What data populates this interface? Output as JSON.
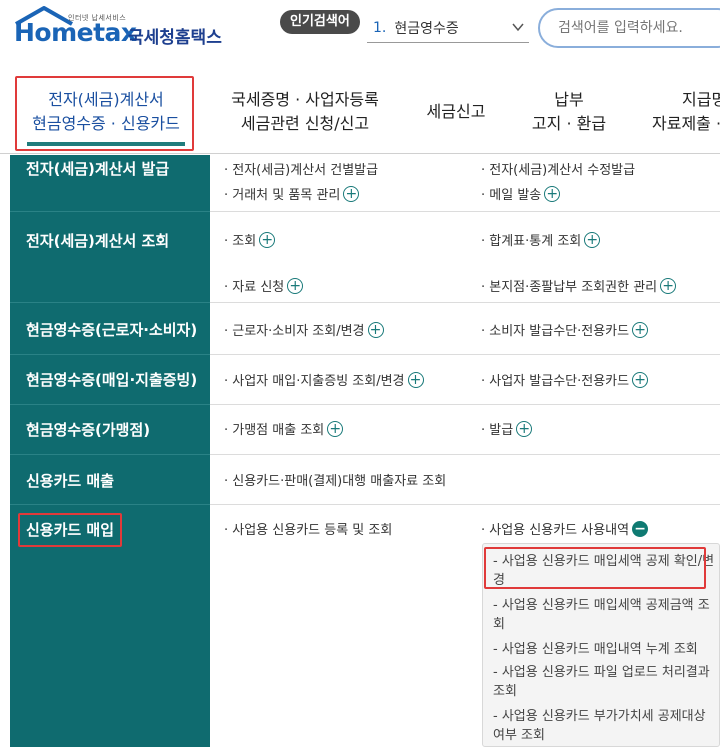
{
  "header": {
    "logo_tagline": "인터넷 납세서비스",
    "logo_text": "Hometax",
    "logo_subtitle": "국세청홈택스",
    "popular_label": "인기검색어",
    "popular_rank": "1.",
    "popular_value": "현금영수증",
    "search_placeholder": "검색어를 입력하세요."
  },
  "nav": {
    "items": [
      {
        "line1": "전자(세금)계산서",
        "line2": "현금영수증 · 신용카드"
      },
      {
        "line1": "국세증명 · 사업자등록",
        "line2": "세금관련 신청/신고"
      },
      {
        "line1": "세금신고",
        "line2": ""
      },
      {
        "line1": "납부",
        "line2": "고지 · 환급"
      },
      {
        "line1": "지급명",
        "line2": "자료제출 ·"
      }
    ]
  },
  "sidebar": {
    "items": [
      {
        "label": "전자(세금)계산서 발급"
      },
      {
        "label": "전자(세금)계산서 조회"
      },
      {
        "label": "현금영수증(근로자·소비자)"
      },
      {
        "label": "현금영수증(매입·지출증빙)"
      },
      {
        "label": "현금영수증(가맹점)"
      },
      {
        "label": "신용카드 매출"
      },
      {
        "label": "신용카드 매입"
      }
    ]
  },
  "menu": {
    "r1c1a": "· 전자(세금)계산서 건별발급",
    "r1c1b": "· 거래처 및 품목 관리",
    "r1c2a": "· 전자(세금)계산서 수정발급",
    "r1c2b": "· 메일 발송",
    "r2c1a": "· 조회",
    "r2c1b": "· 자료 신청",
    "r2c2a": "· 합계표·통계 조회",
    "r2c2b": "· 본지점·종팔납부 조회권한 관리",
    "r3c1": "· 근로자·소비자 조회/변경",
    "r3c2": "· 소비자 발급수단·전용카드",
    "r4c1": "· 사업자 매입·지출증빙 조회/변경",
    "r4c2": "· 사업자 발급수단·전용카드",
    "r5c1": "· 가맹점 매출 조회",
    "r5c2": "· 발급",
    "r6c1": "· 신용카드·판매(결제)대행 매출자료 조회",
    "r7c1": "· 사업용 신용카드 등록 및 조회",
    "r7c2": "· 사업용 신용카드 사용내역"
  },
  "submenu": [
    "- 사업용 신용카드 매입세액 공제 확인/변경",
    "- 사업용 신용카드 매입세액 공제금액 조회",
    "- 사업용 신용카드 매입내역 누계 조회",
    "- 사업용 신용카드 파일 업로드 처리결과 조회",
    "- 사업용 신용카드 부가가치세 공제대상 여부 조회"
  ],
  "colors": {
    "sidebar_bg": "#0f6b6f",
    "brand_blue": "#1a64b6",
    "highlight_red": "#e03a3a",
    "plus_icon": "#1a7a7a"
  }
}
